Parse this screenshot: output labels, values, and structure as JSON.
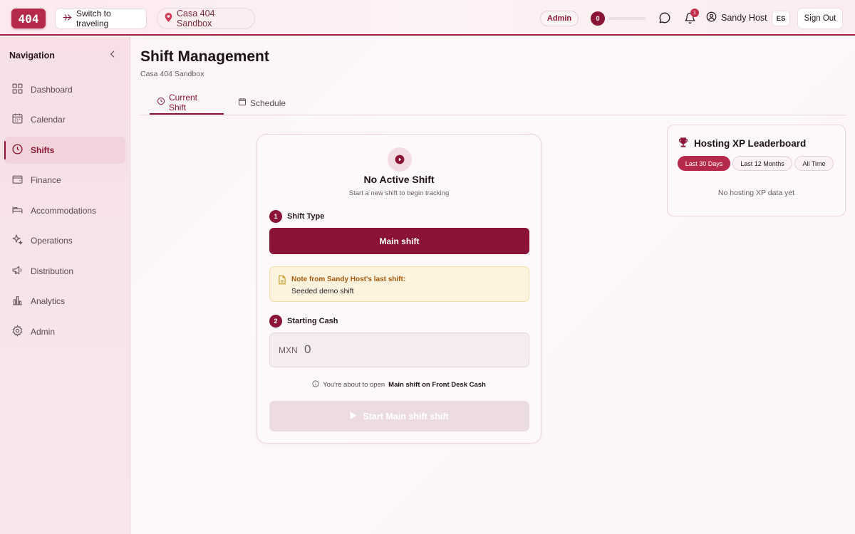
{
  "header": {
    "logo_text": "404",
    "switch_label": "Switch to traveling",
    "property_label": "Casa 404 Sandbox",
    "role_badge": "Admin",
    "xp_value": "0",
    "xp_progress": 0.0,
    "notification_count": "1",
    "user_name": "Sandy Host",
    "language": "ES",
    "sign_out_label": "Sign Out"
  },
  "sidebar": {
    "title": "Navigation",
    "items": [
      {
        "label": "Dashboard",
        "icon": "grid-icon"
      },
      {
        "label": "Calendar",
        "icon": "calendar-icon"
      },
      {
        "label": "Shifts",
        "icon": "clock-icon",
        "active": true
      },
      {
        "label": "Finance",
        "icon": "wallet-icon"
      },
      {
        "label": "Accommodations",
        "icon": "bed-icon"
      },
      {
        "label": "Operations",
        "icon": "sparkles-icon"
      },
      {
        "label": "Distribution",
        "icon": "megaphone-icon"
      },
      {
        "label": "Analytics",
        "icon": "bar-chart-icon"
      },
      {
        "label": "Admin",
        "icon": "gear-icon"
      }
    ]
  },
  "main": {
    "title": "Shift Management",
    "subtitle": "Casa 404 Sandbox",
    "tabs": [
      {
        "label": "Current Shift",
        "active": true
      },
      {
        "label": "Schedule",
        "active": false
      }
    ]
  },
  "shift_card": {
    "title": "No Active Shift",
    "subtitle": "Start a new shift to begin tracking",
    "step1_number": "1",
    "step1_label": "Shift Type",
    "shift_type_value": "Main shift",
    "note_heading": "Note from Sandy Host's last shift:",
    "note_body": "Seeded demo shift",
    "step2_number": "2",
    "step2_label": "Starting Cash",
    "currency": "MXN",
    "cash_value": "0",
    "info_prefix": "You're about to open",
    "info_bold": "Main shift on Front Desk Cash",
    "start_label": "Start Main shift shift"
  },
  "leaderboard": {
    "title": "Hosting XP Leaderboard",
    "filters": [
      "Last 30 Days",
      "Last 12 Months",
      "All Time"
    ],
    "active_filter": "Last 30 Days",
    "empty_text": "No hosting XP data yet"
  },
  "colors": {
    "brand": "#8a1538",
    "brand_light": "#b5294a",
    "note_bg": "#fdf3df",
    "note_text": "#a85a10"
  }
}
